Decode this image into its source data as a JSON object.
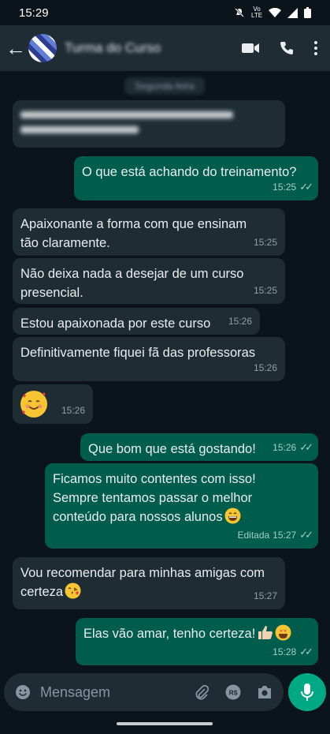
{
  "status_bar": {
    "time": "15:29",
    "volte": "Vo LTE"
  },
  "header": {
    "back": "←",
    "contact_name": "Turma do Curso"
  },
  "date_chip": "Segunda-feira",
  "input": {
    "placeholder": "Mensagem"
  },
  "messages": [
    {
      "dir": "in",
      "text": "",
      "time": "",
      "blurred": true
    },
    {
      "dir": "out",
      "text": "O que está achando do treinamento?",
      "time": "15:25",
      "ticks": "✓✓"
    },
    {
      "dir": "in",
      "text": "Apaixonante a forma com que ensinam\ntão claramente.",
      "time": "15:25"
    },
    {
      "dir": "in",
      "text": "Não deixa nada a desejar de um curso\npresencial.",
      "time": "15:25"
    },
    {
      "dir": "in",
      "text": "Estou apaixonada por este curso",
      "time": "15:26"
    },
    {
      "dir": "in",
      "text": "Definitivamente fiquei fã das professoras",
      "time": "15:26"
    },
    {
      "dir": "in",
      "text": "",
      "time": "15:26",
      "emoji": "smiling-face-with-hearts"
    },
    {
      "dir": "out",
      "text": "Que bom que está gostando!",
      "time": "15:26",
      "ticks": "✓✓"
    },
    {
      "dir": "out",
      "text": "Ficamos muito contentes com isso!\nSempre tentamos passar o melhor\nconteúdo para nossos alunos",
      "time": "15:27",
      "edited": "Editada",
      "ticks": "✓✓"
    },
    {
      "dir": "in",
      "text": "Vou recomendar para minhas amigas com\ncerteza",
      "time": "15:27"
    },
    {
      "dir": "out",
      "text": "Elas vão amar, tenho certeza!",
      "time": "15:28",
      "ticks": "✓✓"
    }
  ],
  "colors": {
    "incoming": "#1f2c34",
    "outgoing": "#005c4b",
    "accent": "#00a884",
    "background": "#0b141a"
  }
}
